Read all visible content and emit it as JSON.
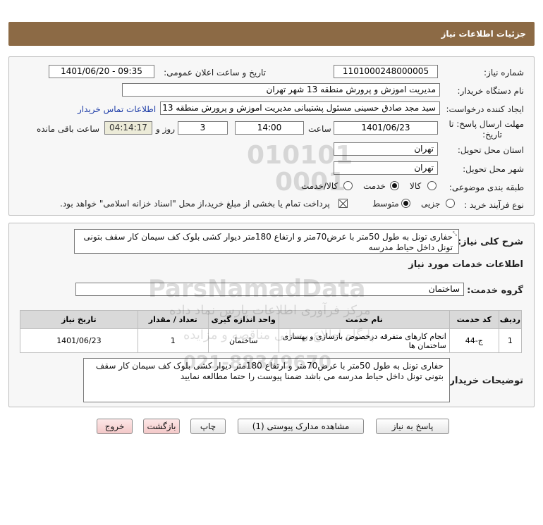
{
  "header": {
    "title": "جزئیات اطلاعات نیاز"
  },
  "form": {
    "need_number_label": "شماره نیاز:",
    "need_number": "1101000248000005",
    "announce_label": "تاریخ و ساعت اعلان عمومی:",
    "announce_value": "1401/06/20 - 09:35",
    "buyer_org_label": "نام دستگاه خریدار:",
    "buyer_org": "مدیریت اموزش و پرورش منطقه 13 شهر تهران",
    "creator_label": "ایجاد کننده درخواست:",
    "creator": "سید مجد صادق حسینی مسئول پشتیبانی مدیریت اموزش و پرورش منطقه 13",
    "contact_link": "اطلاعات تماس خریدار",
    "deadline_label_1": "مهلت ارسال پاسخ: تا",
    "deadline_label_2": "تاریخ:",
    "deadline_date": "1401/06/23",
    "time_label": "ساعت",
    "deadline_time": "14:00",
    "days_value": "3",
    "days_label": "روز و",
    "remaining_time": "04:14:17",
    "remaining_label": "ساعت باقی مانده",
    "province_label": "استان محل تحویل:",
    "province": "تهران",
    "city_label": "شهر محل تحویل:",
    "city": "تهران",
    "category_label": "طبقه بندی موضوعی:",
    "category_options": [
      "کالا",
      "خدمت",
      "کالا/خدمت"
    ],
    "category_selected": "خدمت",
    "process_label": "نوع فرآیند خرید :",
    "process_options": [
      "جزیی",
      "متوسط"
    ],
    "process_selected": "متوسط",
    "payment_note": "پرداخت تمام یا بخشی از مبلغ خرید،از محل \"اسناد خزانه اسلامی\" خواهد بود."
  },
  "summary": {
    "label": "شرح کلی نیاز:",
    "text": "حفاری تونل به طول 50متر با عرض70متر و ارتفاع 180متر دیوار کشی بلوک کف سیمان کار سقف بتونی تونل داخل حیاط مدرسه"
  },
  "services": {
    "section_title": "اطلاعات خدمات مورد نیاز",
    "group_label": "گروه خدمت:",
    "group_value": "ساختمان",
    "columns": [
      "ردیف",
      "کد خدمت",
      "نام خدمت",
      "واحد اندازه گیری",
      "تعداد / مقدار",
      "تاریخ نیاز"
    ],
    "rows": [
      {
        "index": "1",
        "code": "ج-44",
        "name": "انجام کارهای متفرقه درخصوص بازسازی و بهسازی ساختمان ها",
        "unit": "ساختمان",
        "qty": "1",
        "date": "1401/06/23"
      }
    ]
  },
  "buyer_notes": {
    "label": "توضیحات خریدار:",
    "text": "حفاری تونل به طول 50متر با عرض70متر و ارتفاع 180متر دیوار کشی بلوک کف سیمان کار سقف بتونی تونل داخل حیاط مدرسه می باشد ضمنا پیوست را حتما مطالعه نمایید"
  },
  "buttons": {
    "respond": "پاسخ به نیاز",
    "attachments": "مشاهده مدارک پیوستی (1)",
    "print": "چاپ",
    "back": "بازگشت",
    "exit": "خروج"
  },
  "watermark": {
    "digits_1": "010101",
    "digits_2": "0001",
    "brand": "ParsNamadData",
    "line_1": "مرکز فرآوری اطلاعات پارس نماد داده",
    "line_2": "پایگاه اطلاع رسانی مناقصه و مزایده",
    "phone": "021-88349670"
  },
  "colors": {
    "header": "#8c6a45",
    "link": "#1f3ea8",
    "panel_bg": "#f7f7f7"
  }
}
